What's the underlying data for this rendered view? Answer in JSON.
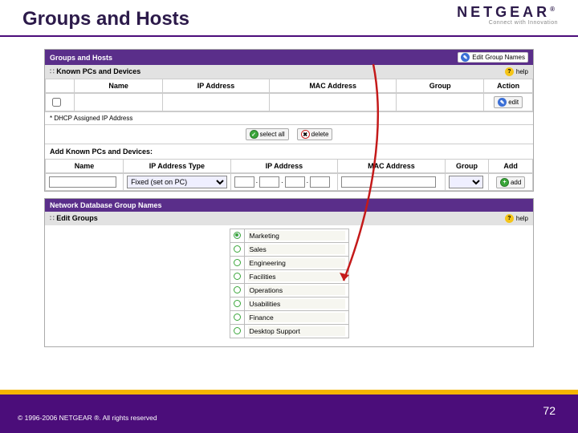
{
  "slide": {
    "title": "Groups and Hosts",
    "logo": {
      "brand": "NETGEAR",
      "reg": "®",
      "tagline": "Connect with Innovation"
    },
    "copyright": "© 1996-2006 NETGEAR ®.  All rights reserved",
    "page": "72"
  },
  "panel1": {
    "title": "Groups and Hosts",
    "edit_link": "Edit Group Names",
    "subheader": "Known PCs and Devices",
    "help": "help",
    "columns": {
      "name": "Name",
      "ip": "IP Address",
      "mac": "MAC Address",
      "group": "Group",
      "action": "Action"
    },
    "edit_btn": "edit",
    "dhcp_note": "* DHCP Assigned IP Address",
    "select_all": "select all",
    "delete": "delete",
    "add_header": "Add Known PCs and Devices:",
    "add_columns": {
      "name": "Name",
      "iptype": "IP Address Type",
      "ip": "IP Address",
      "mac": "MAC Address",
      "group": "Group",
      "add": "Add"
    },
    "iptype_value": "Fixed (set on PC)",
    "add_btn": "add"
  },
  "panel2": {
    "title": "Network Database Group Names",
    "subheader": "Edit Groups",
    "help": "help",
    "groups": [
      "Marketing",
      "Sales",
      "Engineering",
      "Facilities",
      "Operations",
      "Usabilities",
      "Finance",
      "Desktop Support"
    ]
  }
}
